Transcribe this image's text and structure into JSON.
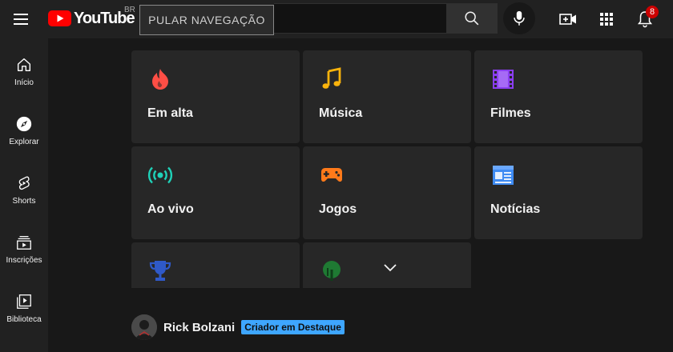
{
  "header": {
    "logo_text": "YouTube",
    "logo_country": "BR",
    "skip_nav_label": "PULAR NAVEGAÇÃO",
    "search_placeholder": "",
    "notification_count": "8"
  },
  "sidebar": {
    "items": [
      {
        "label": "Início",
        "icon": "home-icon"
      },
      {
        "label": "Explorar",
        "icon": "compass-icon"
      },
      {
        "label": "Shorts",
        "icon": "shorts-icon"
      },
      {
        "label": "Inscrições",
        "icon": "subscriptions-icon"
      },
      {
        "label": "Biblioteca",
        "icon": "library-icon"
      }
    ]
  },
  "categories": [
    {
      "label": "Em alta",
      "icon": "trending-flame-icon",
      "color": "#ff4e45"
    },
    {
      "label": "Música",
      "icon": "music-note-icon",
      "color": "#f9b30c"
    },
    {
      "label": "Filmes",
      "icon": "film-icon",
      "color": "#8b3ef1"
    },
    {
      "label": "Ao vivo",
      "icon": "live-broadcast-icon",
      "color": "#1fd1b8"
    },
    {
      "label": "Jogos",
      "icon": "gamepad-icon",
      "color": "#ff7a1a"
    },
    {
      "label": "Notícias",
      "icon": "news-icon",
      "color": "#3e8bf3"
    },
    {
      "label": "",
      "icon": "trophy-icon",
      "color": "#2f59c8"
    },
    {
      "label": "",
      "icon": "fashion-tree-icon",
      "color": "#2a8a3a"
    }
  ],
  "creator": {
    "name": "Rick Bolzani",
    "badge": "Criador em Destaque"
  },
  "colors": {
    "header_bg": "#212121",
    "page_bg": "#181818",
    "card_bg": "#272727",
    "brand_red": "#ff0000",
    "badge_blue": "#3ea6ff"
  }
}
